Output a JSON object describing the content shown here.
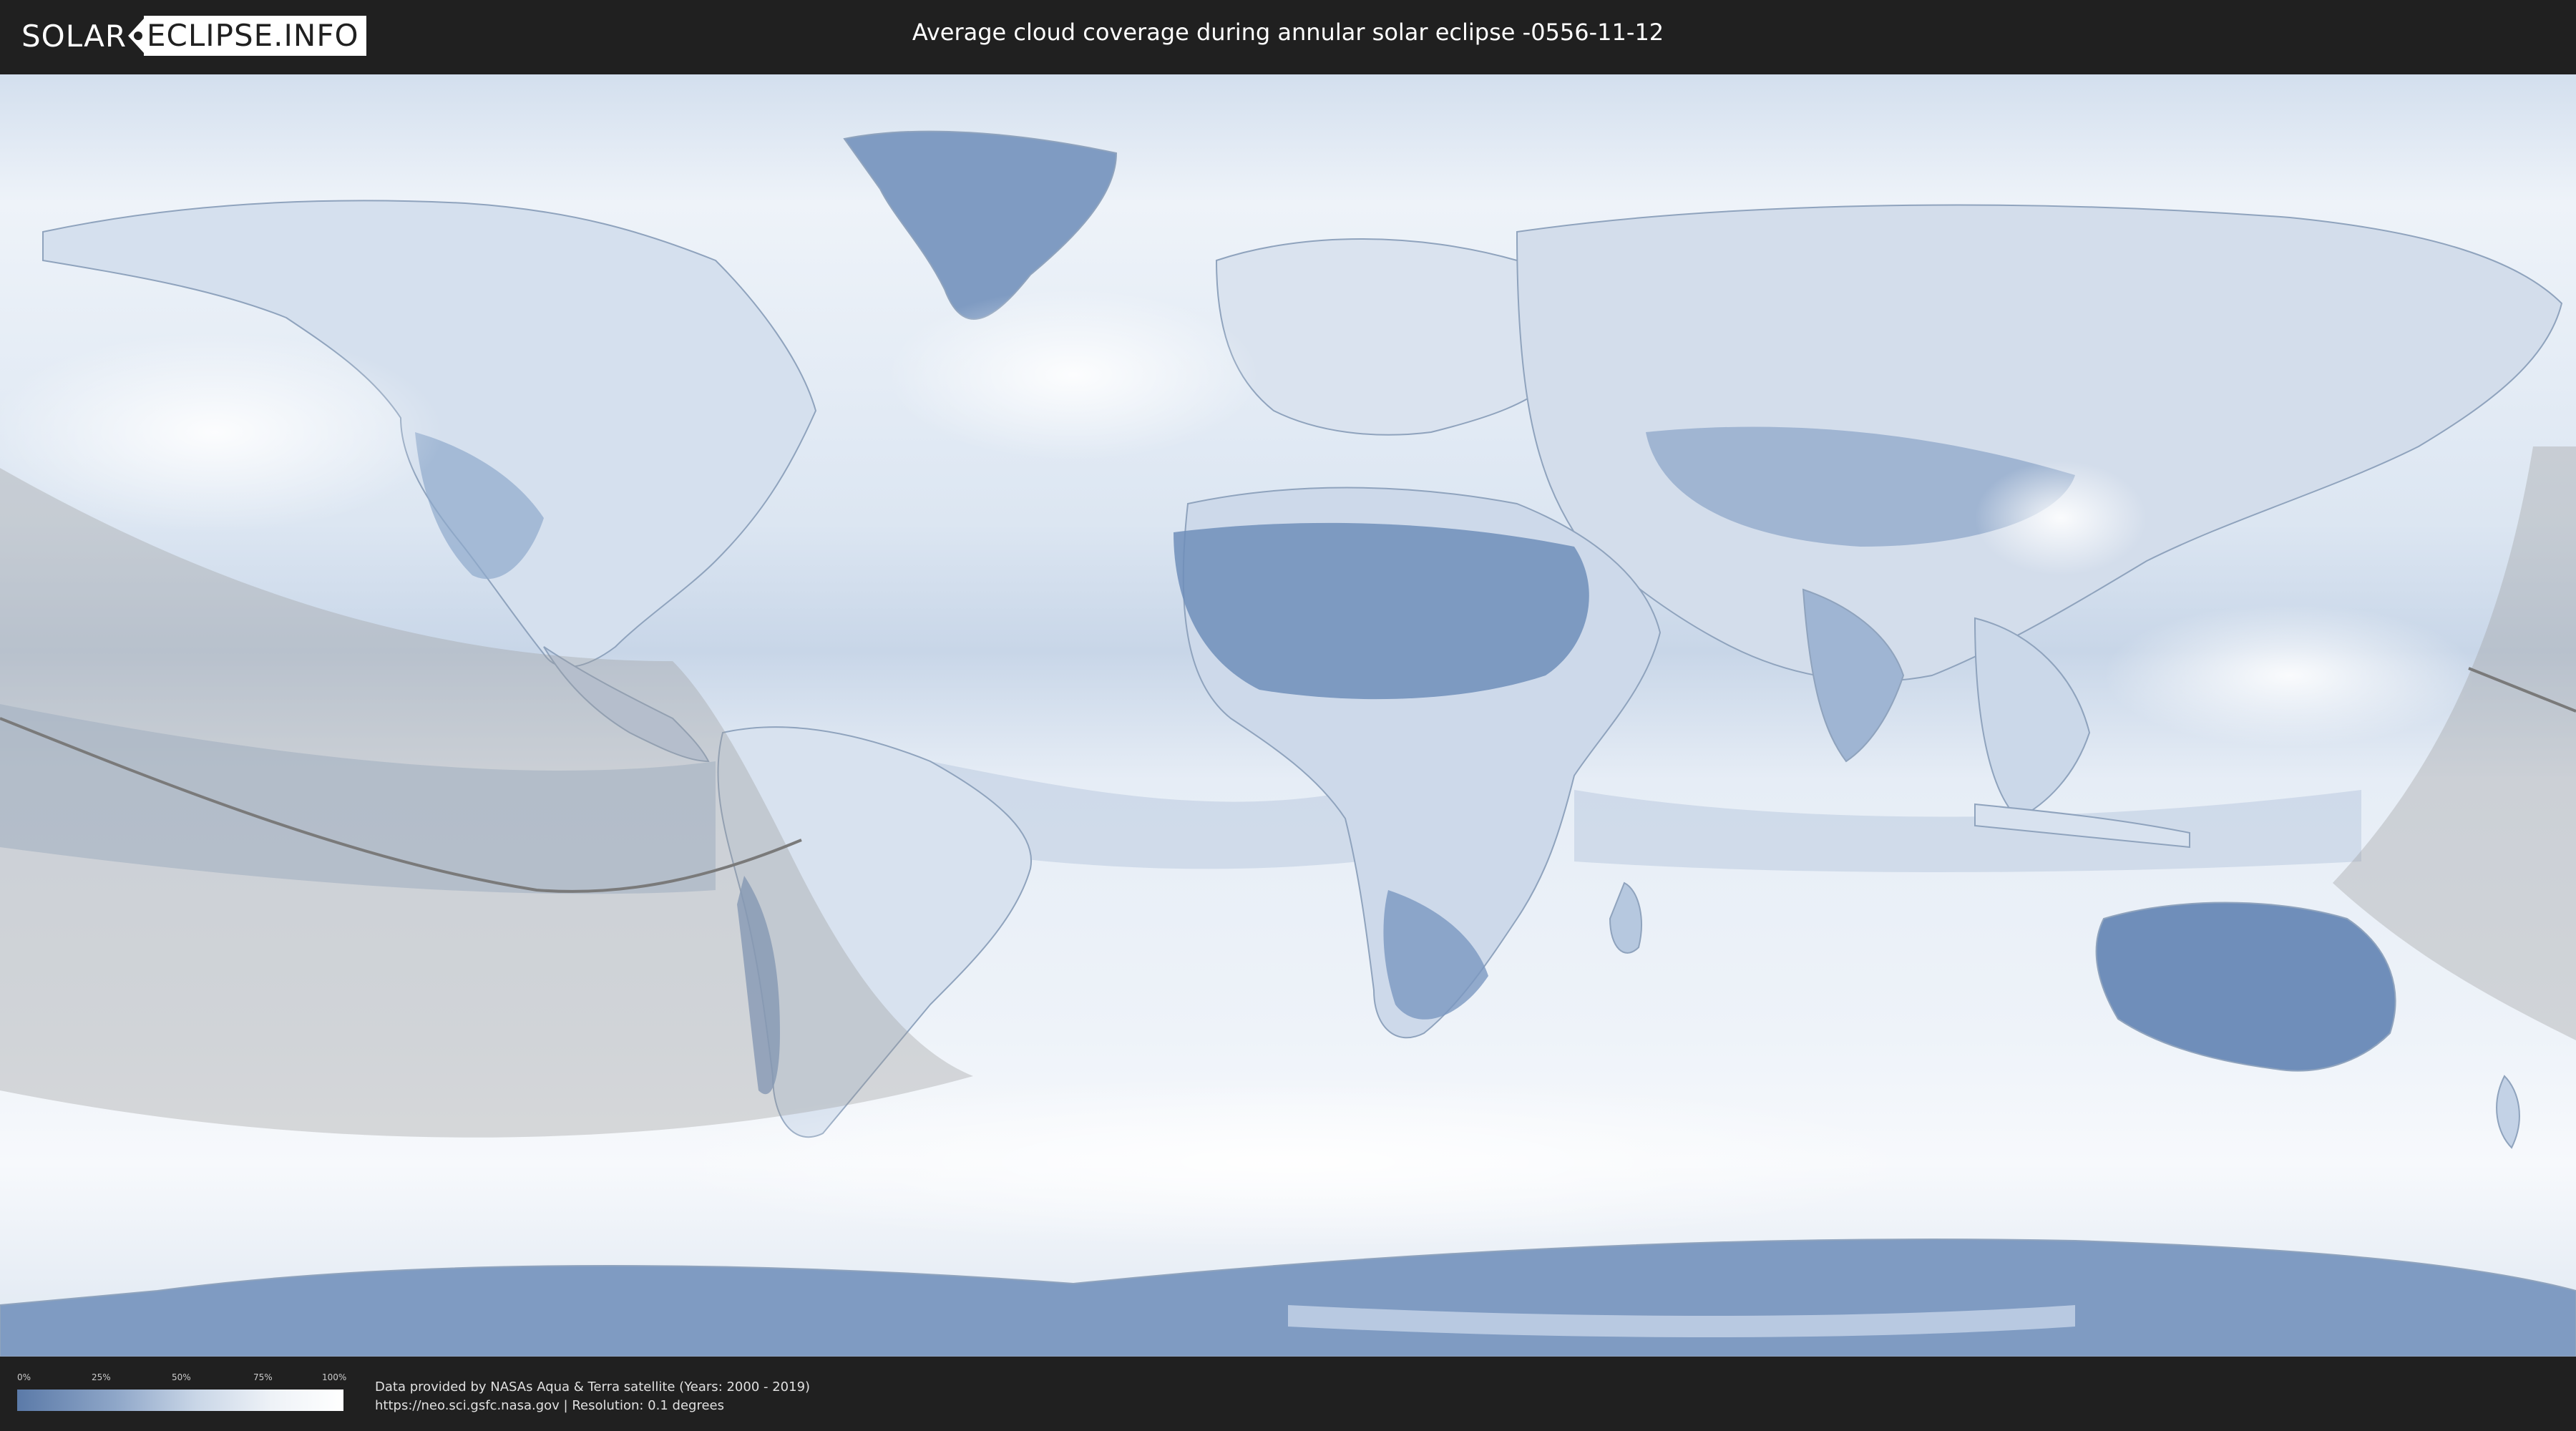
{
  "header": {
    "logo_left": "SOLAR",
    "logo_right": "ECLIPSE.INFO",
    "title": "Average cloud coverage during annular solar eclipse -0556-11-12"
  },
  "map": {
    "type": "world cloud coverage map",
    "projection": "equirectangular",
    "eclipse_path_color": "#8a8a8a",
    "land_outline_color": "#8fa3bd"
  },
  "legend": {
    "ticks": [
      "0%",
      "25%",
      "50%",
      "75%",
      "100%"
    ],
    "colors": [
      "#5b7aa8",
      "#8ea6c8",
      "#c9d6e7",
      "#eef2f7",
      "#ffffff"
    ]
  },
  "footer": {
    "credit_line1": "Data provided by NASAs Aqua & Terra satellite (Years: 2000 - 2019)",
    "credit_line2": "https://neo.sci.gsfc.nasa.gov | Resolution: 0.1 degrees"
  }
}
